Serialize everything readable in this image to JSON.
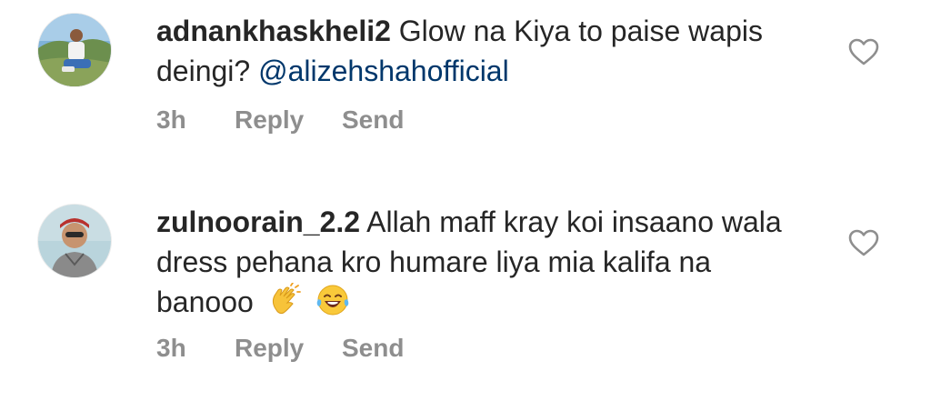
{
  "comments": [
    {
      "username": "adnankhaskheli2",
      "text": "Glow na Kiya to paise wapis deingi?",
      "mention": "@alizehshahofficial",
      "time": "3h",
      "reply_label": "Reply",
      "send_label": "Send",
      "like_icon": "heart-outline-icon"
    },
    {
      "username": "zulnoorain_2.2",
      "text": "Allah maff kray koi insaano wala dress pehana kro humare liya mia kalifa na banooo",
      "emojis": [
        "clapping-hands-emoji",
        "laughing-tears-emoji"
      ],
      "time": "3h",
      "reply_label": "Reply",
      "send_label": "Send",
      "like_icon": "heart-outline-icon"
    }
  ],
  "colors": {
    "text": "#262626",
    "secondary": "#8e8e8e",
    "mention": "#00376b"
  }
}
